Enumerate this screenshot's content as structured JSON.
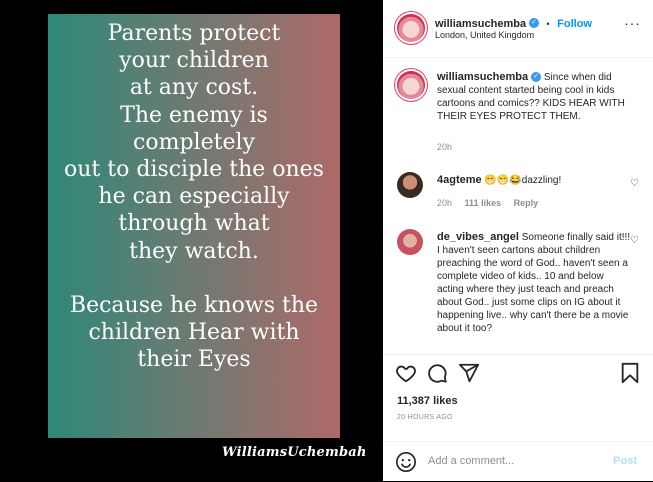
{
  "media": {
    "lines": [
      "Parents protect",
      "your children",
      "at any cost.",
      "The enemy is",
      "completely",
      "out to disciple the ones",
      "he can especially",
      "through what",
      "they watch.",
      "",
      "Because he knows the",
      "children Hear with",
      "their Eyes"
    ],
    "signature": "WilliamsUchembah"
  },
  "header": {
    "username": "williamsuchemba",
    "dot": "•",
    "follow_label": "Follow",
    "location": "London, United Kingdom"
  },
  "caption": {
    "username": "williamsuchemba",
    "text": "Since when did sexual content started being cool in kids cartoons and comics?? KIDS HEAR WITH THEIR EYES PROTECT THEM.",
    "time": "20h"
  },
  "comments": [
    {
      "username": "4agteme",
      "text": "😁😁😂dazzling!",
      "time": "20h",
      "likes": "111 likes",
      "reply": "Reply"
    },
    {
      "username": "de_vibes_angel",
      "text": "Someone finally said it!!! I haven't seen cartons about children preaching the word of God.. haven't seen a complete video of kids.. 10 and below acting where they just teach and preach about God.. just some clips on IG about it happening live.. why can't there be a movie about it too?"
    }
  ],
  "actions": {
    "likes": "11,387 likes",
    "time_ago": "20 HOURS AGO"
  },
  "add_comment": {
    "placeholder": "Add a comment...",
    "post_label": "Post"
  },
  "icons": {
    "like": "heart-icon",
    "comment": "comment-icon",
    "share": "share-icon",
    "save": "bookmark-icon",
    "emoji": "smiley-icon",
    "verified": "verified-badge-icon"
  },
  "colors": {
    "accent": "#0095f6",
    "verified": "#3897f0",
    "post_disabled": "#b2dffc"
  }
}
